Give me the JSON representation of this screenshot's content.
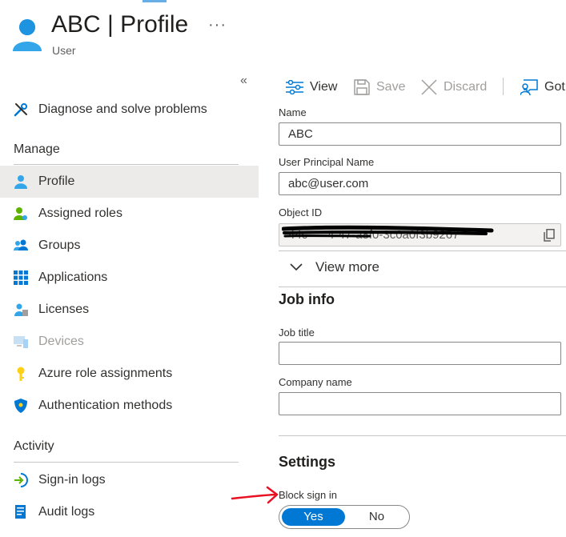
{
  "header": {
    "title": "ABC | Profile",
    "subtitle": "User",
    "more_label": "···"
  },
  "sidebar": {
    "collapse_label": "«",
    "top_item": {
      "label": "Diagnose and solve problems",
      "icon": "wrench-screwdriver-icon"
    },
    "sections": [
      {
        "title": "Manage",
        "items": [
          {
            "label": "Profile",
            "icon": "user-icon",
            "selected": true
          },
          {
            "label": "Assigned roles",
            "icon": "user-role-icon"
          },
          {
            "label": "Groups",
            "icon": "groups-icon"
          },
          {
            "label": "Applications",
            "icon": "apps-grid-icon"
          },
          {
            "label": "Licenses",
            "icon": "license-icon"
          },
          {
            "label": "Devices",
            "icon": "devices-icon",
            "disabled": true
          },
          {
            "label": "Azure role assignments",
            "icon": "key-icon"
          },
          {
            "label": "Authentication methods",
            "icon": "shield-icon"
          }
        ]
      },
      {
        "title": "Activity",
        "items": [
          {
            "label": "Sign-in logs",
            "icon": "sign-in-icon"
          },
          {
            "label": "Audit logs",
            "icon": "audit-log-icon"
          }
        ]
      }
    ]
  },
  "toolbar": {
    "view_label": "View",
    "save_label": "Save",
    "discard_label": "Discard",
    "got_label": "Got"
  },
  "form": {
    "name_label": "Name",
    "name_value": "ABC",
    "upn_label": "User Principal Name",
    "upn_value": "abc@user.com",
    "object_id_label": "Object ID",
    "object_id_value": "44c-----4-47-a8f0-3c0a0f3b9267",
    "view_more_label": "View more",
    "job_info_title": "Job info",
    "job_title_label": "Job title",
    "job_title_value": "",
    "company_label": "Company name",
    "company_value": "",
    "settings_title": "Settings",
    "block_signin_label": "Block sign in",
    "toggle_yes": "Yes",
    "toggle_no": "No",
    "toggle_selected": "Yes"
  },
  "colors": {
    "accent": "#0078d4",
    "annotation_arrow": "#e81123",
    "redaction": "#000000"
  }
}
